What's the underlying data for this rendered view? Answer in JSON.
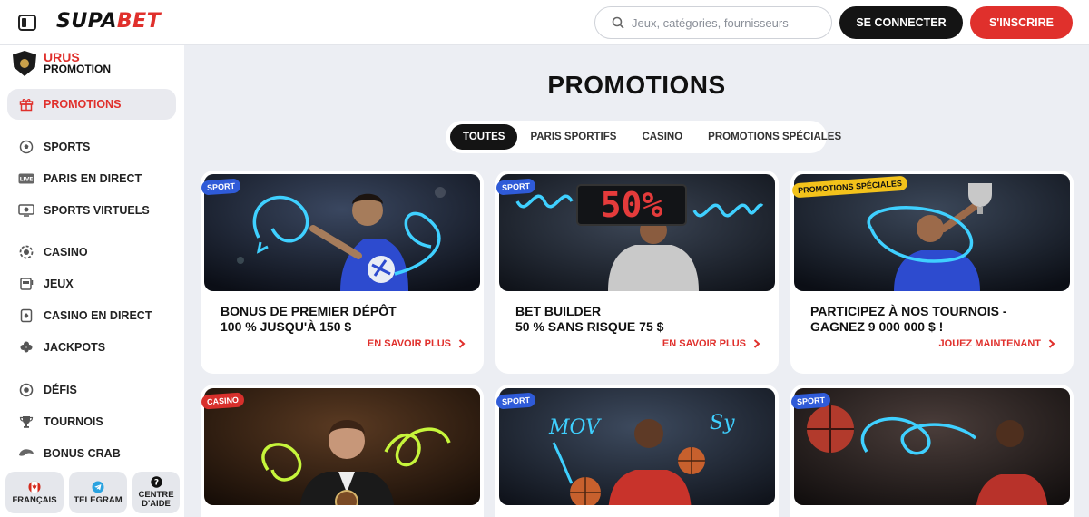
{
  "header": {
    "logo_part1": "SUPA",
    "logo_part2": "BET",
    "search_placeholder": "Jeux, catégories, fournisseurs",
    "login_label": "SE CONNECTER",
    "signup_label": "S'INSCRIRE"
  },
  "sidebar": {
    "banner": {
      "line1": "URUS",
      "line2": "PROMOTION"
    },
    "items": [
      {
        "label": "PROMOTIONS",
        "icon": "gift-icon"
      },
      {
        "label": "SPORTS",
        "icon": "soccer-ball-icon"
      },
      {
        "label": "PARIS EN DIRECT",
        "icon": "live-icon"
      },
      {
        "label": "SPORTS VIRTUELS",
        "icon": "virtual-sports-icon"
      },
      {
        "label": "CASINO",
        "icon": "casino-chip-icon"
      },
      {
        "label": "JEUX",
        "icon": "slot-machine-icon"
      },
      {
        "label": "CASINO EN DIRECT",
        "icon": "card-icon"
      },
      {
        "label": "JACKPOTS",
        "icon": "clover-icon"
      },
      {
        "label": "DÉFIS",
        "icon": "challenge-icon"
      },
      {
        "label": "TOURNOIS",
        "icon": "trophy-icon"
      },
      {
        "label": "BONUS CRAB",
        "icon": "crab-icon"
      }
    ],
    "bottom": [
      {
        "label": "FRANÇAIS",
        "icon": "canada-flag-icon"
      },
      {
        "label": "TELEGRAM",
        "icon": "telegram-icon"
      },
      {
        "label": "CENTRE D'AIDE",
        "icon": "help-icon"
      }
    ]
  },
  "main": {
    "title": "PROMOTIONS",
    "tabs": [
      {
        "label": "TOUTES",
        "active": true
      },
      {
        "label": "PARIS SPORTIFS",
        "active": false
      },
      {
        "label": "CASINO",
        "active": false
      },
      {
        "label": "PROMOTIONS SPÉCIALES",
        "active": false
      }
    ],
    "cards": [
      {
        "badge": "SPORT",
        "badge_type": "sport",
        "title_line1": "BONUS DE PREMIER DÉPÔT",
        "title_line2": "100 % JUSQU'À 150 $",
        "link": "EN SAVOIR PLUS"
      },
      {
        "badge": "SPORT",
        "badge_type": "sport",
        "title_line1": "BET BUILDER",
        "title_line2": "50 % SANS RISQUE 75 $",
        "link": "EN SAVOIR PLUS",
        "scoreboard_text": "50%"
      },
      {
        "badge": "PROMOTIONS SPÉCIALES",
        "badge_type": "special",
        "title_line1": "PARTICIPEZ À NOS TOURNOIS -",
        "title_line2": "GAGNEZ 9 000 000 $ !",
        "link": "JOUEZ MAINTENANT"
      },
      {
        "badge": "CASINO",
        "badge_type": "casino"
      },
      {
        "badge": "SPORT",
        "badge_type": "sport",
        "doodle1": "MOV",
        "doodle2": "Sy"
      },
      {
        "badge": "SPORT",
        "badge_type": "sport"
      }
    ]
  },
  "colors": {
    "accent": "#e0302c",
    "dark": "#141414",
    "sport_badge": "#2f5bd8",
    "special_badge": "#f3c21b",
    "neon": "#3fd0ff",
    "lime": "#c6f53b"
  }
}
